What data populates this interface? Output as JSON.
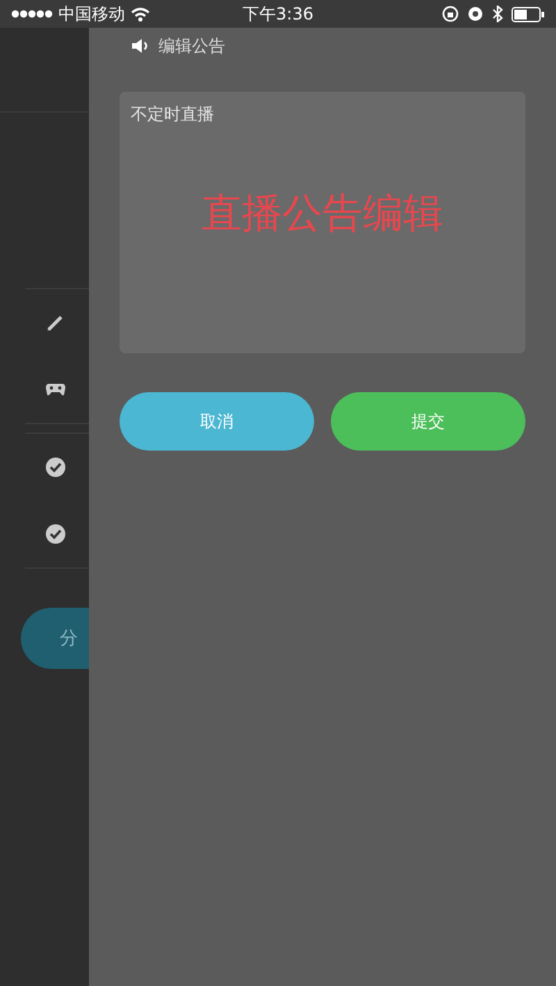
{
  "status_bar": {
    "carrier": "中国移动",
    "time": "下午3:36"
  },
  "side_menu": {
    "items": [
      {
        "kind": "edit"
      },
      {
        "kind": "game"
      },
      {
        "kind": "check"
      },
      {
        "kind": "check"
      }
    ],
    "share_button": {
      "label": "分"
    }
  },
  "dialog": {
    "title": "编辑公告",
    "announcement": {
      "value": "不定时直播"
    },
    "caption": "直播公告编辑",
    "buttons": [
      {
        "label": "取消",
        "kind": "cancel"
      },
      {
        "label": "提交",
        "kind": "submit"
      }
    ]
  }
}
